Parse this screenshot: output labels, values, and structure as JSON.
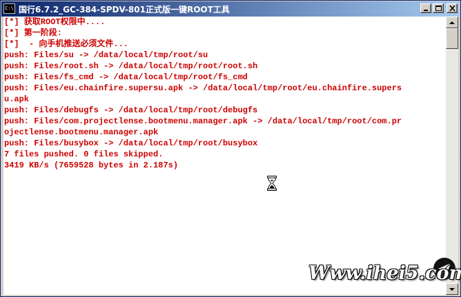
{
  "window": {
    "title": "国行6.7.2_GC-384-SPDV-801正式版一键ROOT工具",
    "icon_label": "C:\\",
    "buttons": [
      "minimize-icon",
      "maximize-icon",
      "close-icon"
    ]
  },
  "console": {
    "text_color": "#cc0000",
    "background": "#ffffff",
    "lines": [
      "[*] 获取ROOT权限中....",
      "[*] 第一阶段:",
      "[*]  - 向手机推送必须文件...",
      "push: Files/su -> /data/local/tmp/root/su",
      "push: Files/root.sh -> /data/local/tmp/root/root.sh",
      "push: Files/fs_cmd -> /data/local/tmp/root/fs_cmd",
      "push: Files/eu.chainfire.supersu.apk -> /data/local/tmp/root/eu.chainfire.supers",
      "u.apk",
      "push: Files/debugfs -> /data/local/tmp/root/debugfs",
      "push: Files/com.projectlense.bootmenu.manager.apk -> /data/local/tmp/root/com.pr",
      "ojectlense.bootmenu.manager.apk",
      "push: Files/busybox -> /data/local/tmp/root/busybox",
      "7 files pushed. 0 files skipped.",
      "3419 KB/s (7659528 bytes in 2.187s)"
    ]
  },
  "cursor": "hourglass-icon",
  "watermark": {
    "text": "Www.ihei5.com"
  }
}
